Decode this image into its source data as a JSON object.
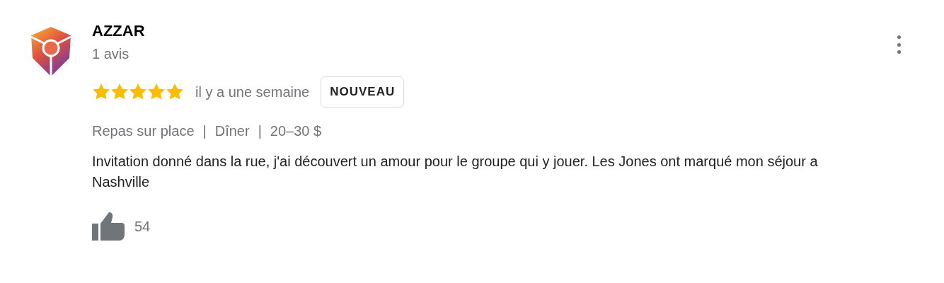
{
  "review": {
    "author": "AZZAR",
    "review_count": "1 avis",
    "stars": 5,
    "time": "il y a une semaine",
    "badge": "NOUVEAU",
    "meta": [
      "Repas sur place",
      "Dîner",
      "20–30 $"
    ],
    "meta_separator": "|",
    "text": "Invitation donné dans la rue, j'ai découvert un amour pour le groupe qui y jouer. Les Jones ont marqué mon séjour a Nashville",
    "likes": "54"
  }
}
